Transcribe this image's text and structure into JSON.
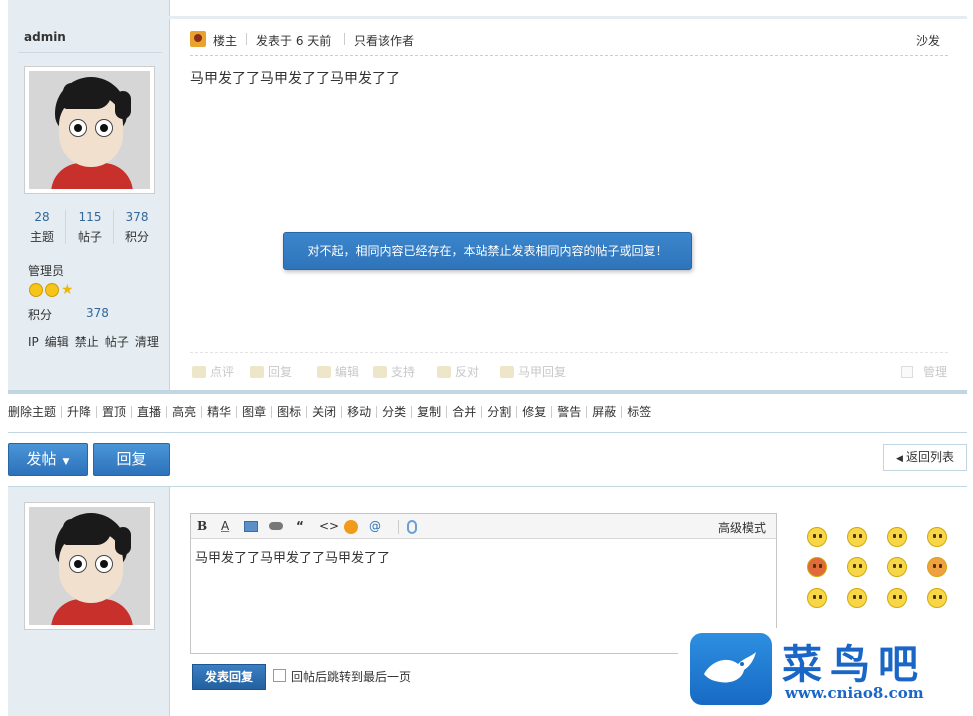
{
  "author": {
    "name": "admin",
    "stats": [
      {
        "value": "28",
        "label": "主题"
      },
      {
        "value": "115",
        "label": "帖子"
      },
      {
        "value": "378",
        "label": "积分"
      }
    ],
    "role": "管理员",
    "score_label": "积分",
    "score_value": "378",
    "admin_links": [
      "IP",
      "编辑",
      "禁止",
      "帖子",
      "清理"
    ]
  },
  "post": {
    "host_label": "楼主",
    "posted_at": "发表于 6 天前",
    "only_author": "只看该作者",
    "floor": "沙发",
    "content": "马甲发了了马甲发了了马甲发了了",
    "actions": [
      "点评",
      "回复",
      "编辑",
      "支持",
      "反对",
      "马甲回复"
    ],
    "manage": "管理"
  },
  "popup_message": "对不起，相同内容已经存在，本站禁止发表相同内容的帖子或回复！",
  "moderator_actions": [
    "删除主题",
    "升降",
    "置顶",
    "直播",
    "高亮",
    "精华",
    "图章",
    "图标",
    "关闭",
    "移动",
    "分类",
    "复制",
    "合并",
    "分割",
    "修复",
    "警告",
    "屏蔽",
    "标签"
  ],
  "buttons": {
    "new_post": "发帖",
    "reply": "回复",
    "back_to_list": "返回列表"
  },
  "editor": {
    "toolbar": [
      "B",
      "A",
      "“",
      "<>",
      "@"
    ],
    "advanced_mode": "高级模式",
    "content": "马甲发了了马甲发了了马甲发了了",
    "submit": "发表回复",
    "jump_label": "回帖后跳转到最后一页"
  },
  "watermark": {
    "title": "菜鸟吧",
    "url": "www.cniao8.com"
  },
  "colors": {
    "accent_blue": "#2f74bb",
    "sidebar_bg": "#e5edf2",
    "border": "#c2d5e3",
    "link": "#336699"
  }
}
